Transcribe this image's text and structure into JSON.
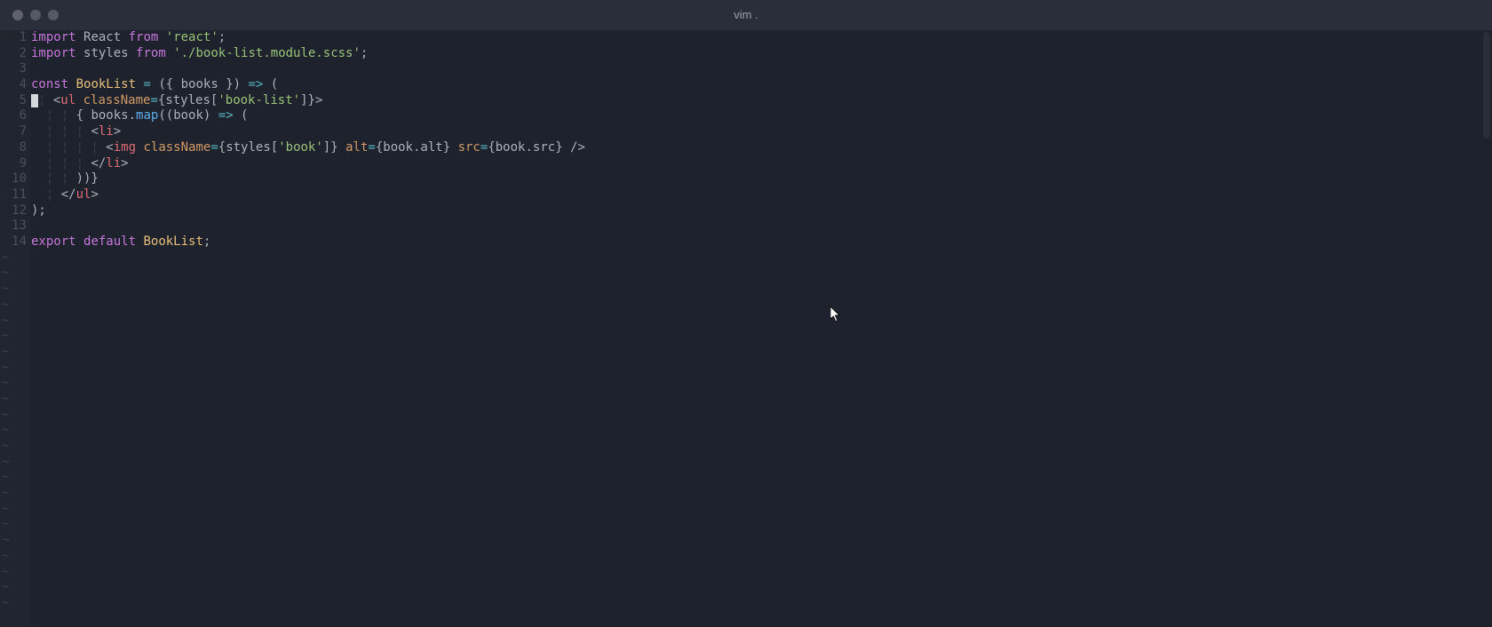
{
  "window": {
    "title": "vim ."
  },
  "editor": {
    "line_count": 14,
    "empty_marker": "~",
    "code_lines": [
      {
        "n": 1,
        "tokens": [
          [
            "kw",
            "import"
          ],
          [
            "punct",
            " "
          ],
          [
            "ident",
            "React"
          ],
          [
            "punct",
            " "
          ],
          [
            "kw",
            "from"
          ],
          [
            "punct",
            " "
          ],
          [
            "str",
            "'react'"
          ],
          [
            "punct",
            ";"
          ]
        ]
      },
      {
        "n": 2,
        "tokens": [
          [
            "kw",
            "import"
          ],
          [
            "punct",
            " "
          ],
          [
            "ident",
            "styles"
          ],
          [
            "punct",
            " "
          ],
          [
            "kw",
            "from"
          ],
          [
            "punct",
            " "
          ],
          [
            "str",
            "'./book-list.module.scss'"
          ],
          [
            "punct",
            ";"
          ]
        ]
      },
      {
        "n": 3,
        "tokens": []
      },
      {
        "n": 4,
        "tokens": [
          [
            "kw",
            "const"
          ],
          [
            "punct",
            " "
          ],
          [
            "comp",
            "BookList"
          ],
          [
            "punct",
            " "
          ],
          [
            "op",
            "="
          ],
          [
            "punct",
            " ("
          ],
          [
            "punct",
            "{ "
          ],
          [
            "ident",
            "books"
          ],
          [
            "punct",
            " }"
          ],
          [
            "punct",
            ") "
          ],
          [
            "op",
            "=>"
          ],
          [
            "punct",
            " ("
          ]
        ]
      },
      {
        "n": 5,
        "cursor_before": true,
        "tokens": [
          [
            "guide",
            "¦ "
          ],
          [
            "tagp",
            "<"
          ],
          [
            "tag",
            "ul"
          ],
          [
            "punct",
            " "
          ],
          [
            "attr",
            "className"
          ],
          [
            "op",
            "="
          ],
          [
            "punct",
            "{"
          ],
          [
            "ident",
            "styles"
          ],
          [
            "punct",
            "["
          ],
          [
            "str",
            "'book-list'"
          ],
          [
            "punct",
            "]}"
          ],
          [
            "tagp",
            ">"
          ]
        ]
      },
      {
        "n": 6,
        "tokens": [
          [
            "guide",
            "  ¦ ¦ "
          ],
          [
            "punct",
            "{ "
          ],
          [
            "ident",
            "books"
          ],
          [
            "punct",
            "."
          ],
          [
            "fn",
            "map"
          ],
          [
            "punct",
            "(("
          ],
          [
            "ident",
            "book"
          ],
          [
            "punct",
            ") "
          ],
          [
            "op",
            "=>"
          ],
          [
            "punct",
            " ("
          ]
        ]
      },
      {
        "n": 7,
        "tokens": [
          [
            "guide",
            "  ¦ ¦ ¦ "
          ],
          [
            "tagp",
            "<"
          ],
          [
            "tag",
            "li"
          ],
          [
            "tagp",
            ">"
          ]
        ]
      },
      {
        "n": 8,
        "tokens": [
          [
            "guide",
            "  ¦ ¦ ¦ ¦ "
          ],
          [
            "tagp",
            "<"
          ],
          [
            "tag",
            "img"
          ],
          [
            "punct",
            " "
          ],
          [
            "attr",
            "className"
          ],
          [
            "op",
            "="
          ],
          [
            "punct",
            "{"
          ],
          [
            "ident",
            "styles"
          ],
          [
            "punct",
            "["
          ],
          [
            "str",
            "'book'"
          ],
          [
            "punct",
            "]} "
          ],
          [
            "attr",
            "alt"
          ],
          [
            "op",
            "="
          ],
          [
            "punct",
            "{"
          ],
          [
            "ident",
            "book"
          ],
          [
            "punct",
            "."
          ],
          [
            "ident",
            "alt"
          ],
          [
            "punct",
            "} "
          ],
          [
            "attr",
            "src"
          ],
          [
            "op",
            "="
          ],
          [
            "punct",
            "{"
          ],
          [
            "ident",
            "book"
          ],
          [
            "punct",
            "."
          ],
          [
            "ident",
            "src"
          ],
          [
            "punct",
            "} "
          ],
          [
            "tagp",
            "/>"
          ]
        ]
      },
      {
        "n": 9,
        "tokens": [
          [
            "guide",
            "  ¦ ¦ ¦ "
          ],
          [
            "tagp",
            "</"
          ],
          [
            "tag",
            "li"
          ],
          [
            "tagp",
            ">"
          ]
        ]
      },
      {
        "n": 10,
        "tokens": [
          [
            "guide",
            "  ¦ ¦ "
          ],
          [
            "punct",
            "))}"
          ]
        ]
      },
      {
        "n": 11,
        "tokens": [
          [
            "guide",
            "  ¦ "
          ],
          [
            "tagp",
            "</"
          ],
          [
            "tag",
            "ul"
          ],
          [
            "tagp",
            ">"
          ]
        ]
      },
      {
        "n": 12,
        "tokens": [
          [
            "punct",
            ");"
          ]
        ]
      },
      {
        "n": 13,
        "tokens": []
      },
      {
        "n": 14,
        "tokens": [
          [
            "kw",
            "export"
          ],
          [
            "punct",
            " "
          ],
          [
            "kw",
            "default"
          ],
          [
            "punct",
            " "
          ],
          [
            "comp",
            "BookList"
          ],
          [
            "punct",
            ";"
          ]
        ]
      }
    ]
  }
}
